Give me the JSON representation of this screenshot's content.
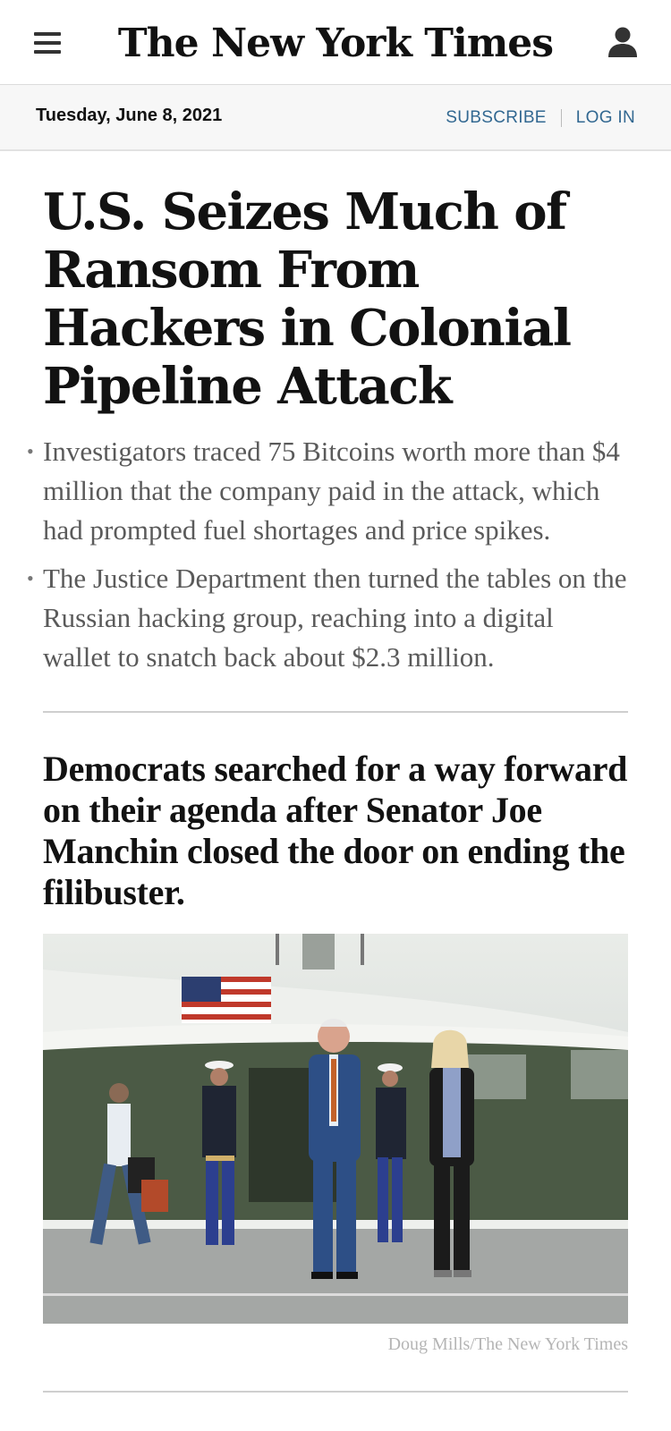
{
  "header": {
    "masthead": "The New York Times",
    "date": "Tuesday, June 8, 2021",
    "subscribe_label": "SUBSCRIBE",
    "login_label": "LOG IN"
  },
  "lead_story": {
    "headline": "U.S. Seizes Much of Ransom From Hackers in Colonial Pipeline Attack",
    "summary": [
      "Investigators traced 75 Bitcoins worth more than $4 million that the company paid in the attack, which had prompted fuel shortages and price spikes.",
      "The Justice Department then turned the tables on the Russian hacking group, reaching into a digital wallet to snatch back about $2.3 million."
    ]
  },
  "second_story": {
    "headline": "Democrats searched for a way forward on their agenda after Senator Joe Manchin closed the door on ending the filibuster.",
    "photo_credit": "Doug Mills/The New York Times"
  },
  "icons": {
    "menu": "hamburger-menu-icon",
    "account": "person-icon"
  },
  "colors": {
    "link_blue": "#326891",
    "text": "#121212",
    "summary_gray": "#5a5a5a"
  }
}
